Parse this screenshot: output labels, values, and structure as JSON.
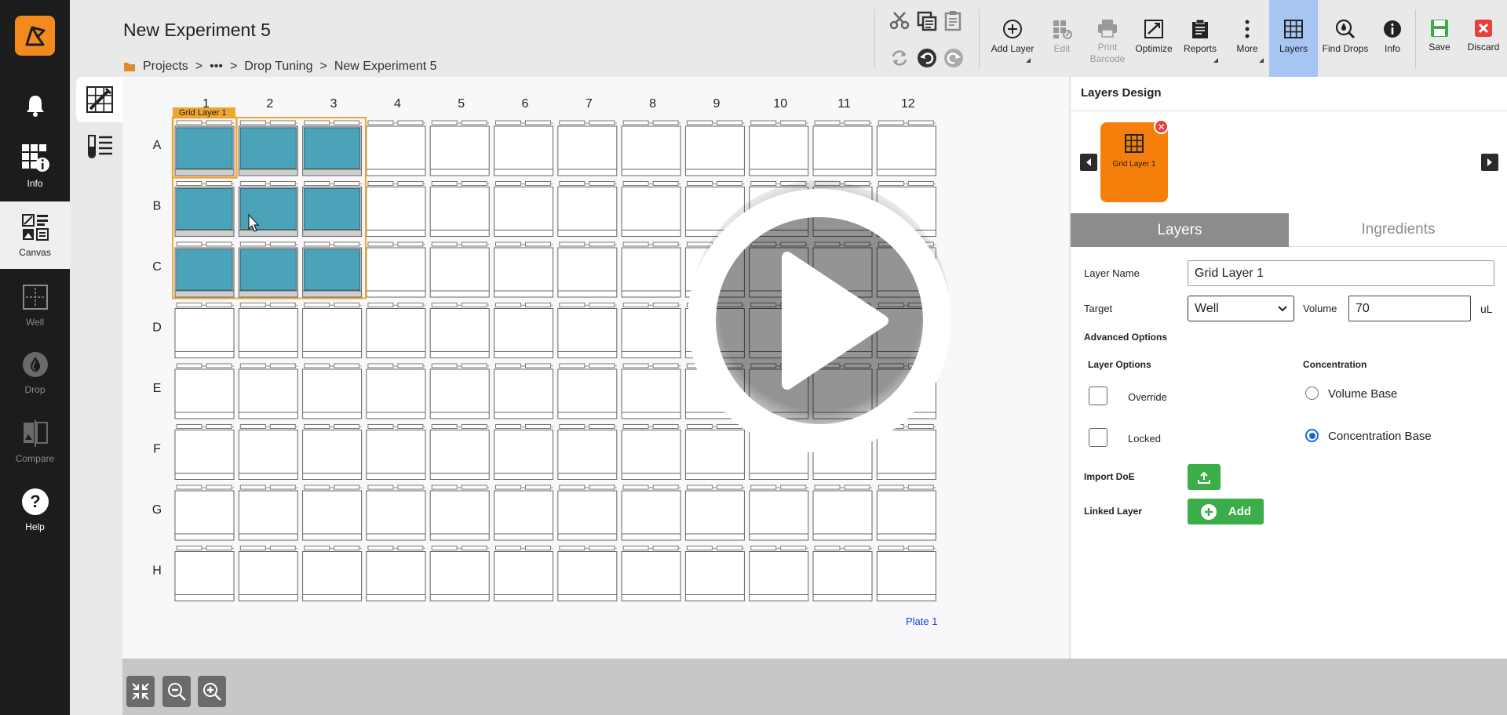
{
  "nav": {
    "items": [
      {
        "label": ""
      },
      {
        "label": "Info"
      },
      {
        "label": "Canvas"
      },
      {
        "label": "Well"
      },
      {
        "label": "Drop"
      },
      {
        "label": "Compare"
      },
      {
        "label": "Help"
      }
    ]
  },
  "header": {
    "title": "New Experiment 5",
    "breadcrumb": [
      "Projects",
      ">",
      "•••",
      ">",
      "Drop Tuning",
      ">",
      "New Experiment 5"
    ]
  },
  "toolbar": {
    "add_layer": "Add Layer",
    "edit": "Edit",
    "print_barcode_1": "Print",
    "print_barcode_2": "Barcode",
    "optimize": "Optimize",
    "reports": "Reports",
    "more": "More",
    "layers": "Layers",
    "find_drops": "Find Drops",
    "info": "Info",
    "save": "Save",
    "discard": "Discard"
  },
  "plate": {
    "columns": [
      "1",
      "2",
      "3",
      "4",
      "5",
      "6",
      "7",
      "8",
      "9",
      "10",
      "11",
      "12"
    ],
    "rows": [
      "A",
      "B",
      "C",
      "D",
      "E",
      "F",
      "G",
      "H"
    ],
    "layer_tag": "Grid Layer 1",
    "filled_rows": [
      0,
      1,
      2
    ],
    "filled_cols": [
      0,
      1,
      2
    ],
    "fill_color": "#4aa3b8",
    "selection_color": "#f0a531",
    "plate_label": "Plate 1"
  },
  "panel": {
    "title": "Layers Design",
    "layer_card_label": "Grid Layer 1",
    "tabs": {
      "layers": "Layers",
      "ingredients": "Ingredients"
    },
    "layer_name_label": "Layer Name",
    "layer_name_value": "Grid Layer 1",
    "target_label": "Target",
    "target_value": "Well",
    "volume_label": "Volume",
    "volume_value": "70",
    "volume_unit": "uL",
    "advanced_options": "Advanced Options",
    "layer_options": "Layer Options",
    "concentration": "Concentration",
    "override": "Override",
    "locked": "Locked",
    "volume_base": "Volume Base",
    "concentration_base": "Concentration Base",
    "import_doe": "Import DoE",
    "linked_layer": "Linked Layer",
    "add": "Add"
  },
  "colors": {
    "accent_orange": "#f4800b",
    "active_toolbar": "#a6c5f2",
    "green": "#3bae49",
    "red": "#e9403c"
  }
}
